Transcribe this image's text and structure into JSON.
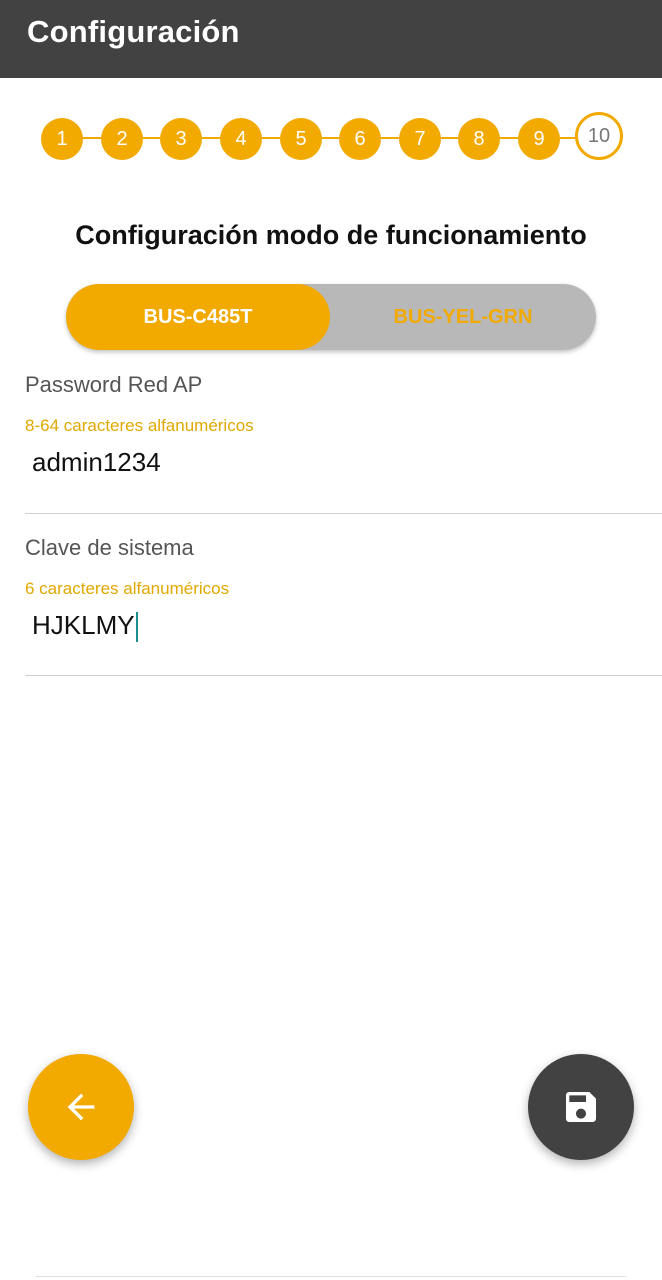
{
  "appbar": {
    "title": "Configuración"
  },
  "stepper": {
    "steps": [
      "1",
      "2",
      "3",
      "4",
      "5",
      "6",
      "7",
      "8",
      "9",
      "10"
    ],
    "current_step": 10
  },
  "section": {
    "title": "Configuración modo de funcionamiento"
  },
  "mode_toggle": {
    "options": [
      "BUS-C485T",
      "BUS-YEL-GRN"
    ],
    "selected": "BUS-C485T"
  },
  "fields": {
    "password": {
      "label": "Password Red AP",
      "hint": "8-64 caracteres alfanuméricos",
      "value": "admin1234"
    },
    "system_key": {
      "label": "Clave de sistema",
      "hint": "6 caracteres alfanuméricos",
      "value": "HJKLMY"
    }
  },
  "actions": {
    "back_icon": "arrow-back-icon",
    "save_icon": "save-icon"
  },
  "colors": {
    "accent": "#F2A900",
    "appbar": "#424242",
    "toggle_inactive_bg": "#b8b8b8",
    "caret": "#1a8f8f"
  }
}
